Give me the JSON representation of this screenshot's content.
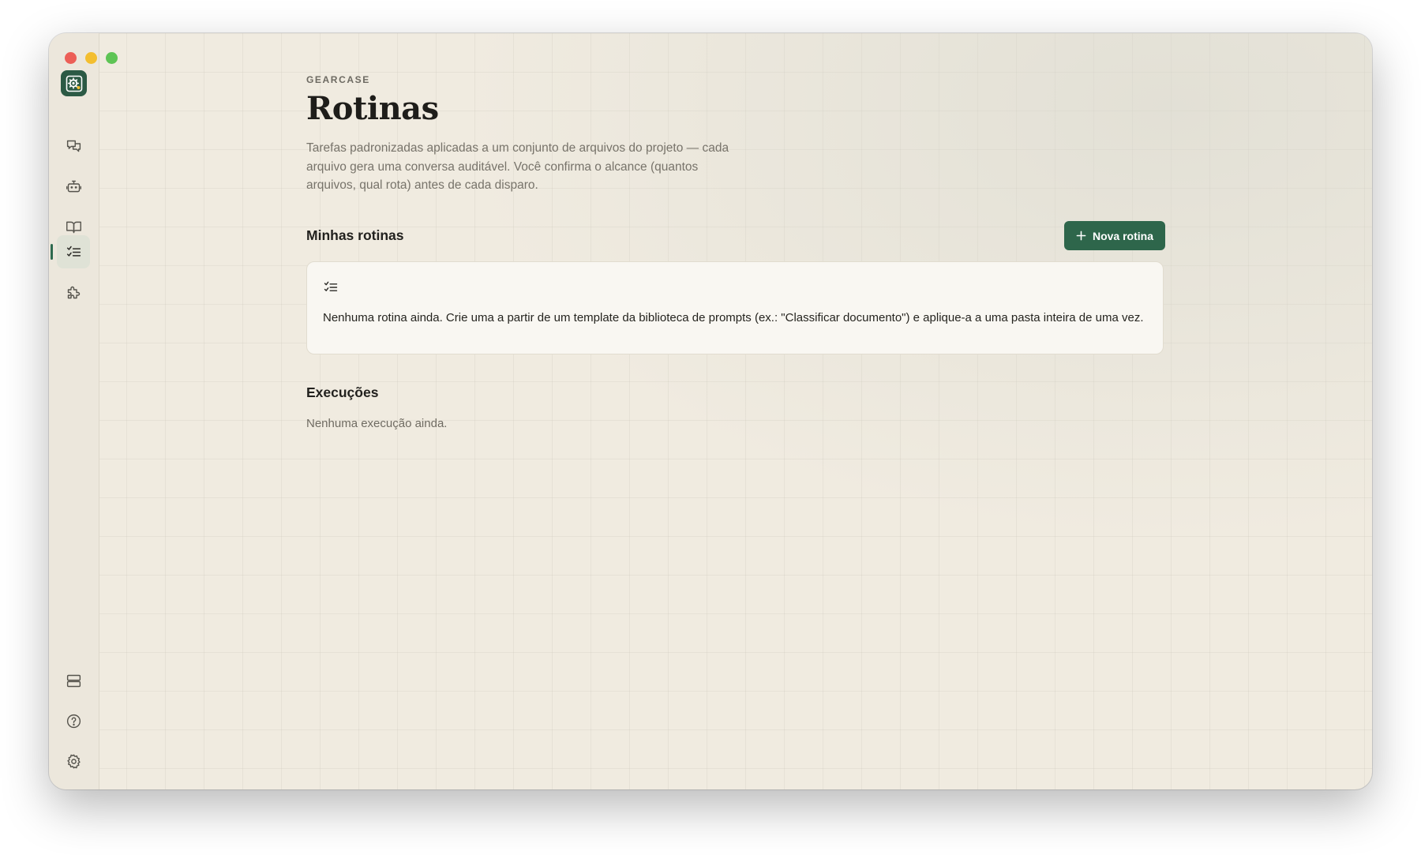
{
  "app": {
    "eyebrow": "GEARCASE"
  },
  "page": {
    "title": "Rotinas",
    "description": "Tarefas padronizadas aplicadas a um conjunto de arquivos do projeto — cada arquivo gera uma conversa auditável. Você confirma o alcance (quantos arquivos, qual rota) antes de cada disparo."
  },
  "routines": {
    "section_title": "Minhas rotinas",
    "new_button_label": "Nova rotina",
    "empty_message": "Nenhuma rotina ainda. Crie uma a partir de um template da biblioteca de prompts (ex.: \"Classificar documento\") e aplique-a a uma pasta inteira de uma vez."
  },
  "executions": {
    "section_title": "Execuções",
    "empty_message": "Nenhuma execução ainda."
  },
  "sidebar": {
    "items": [
      {
        "icon": "chat-bubbles-icon"
      },
      {
        "icon": "robot-icon"
      },
      {
        "icon": "book-icon"
      },
      {
        "icon": "checklist-icon",
        "active": true
      },
      {
        "icon": "puzzle-icon"
      }
    ],
    "bottom_items": [
      {
        "icon": "server-icon"
      },
      {
        "icon": "help-icon"
      },
      {
        "icon": "gear-icon"
      }
    ]
  },
  "colors": {
    "accent": "#2e664b",
    "background": "#f0ebe0",
    "card": "#f9f7f2"
  }
}
